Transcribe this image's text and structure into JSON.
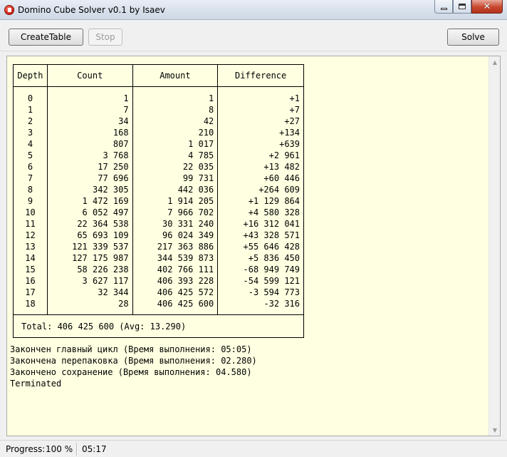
{
  "window": {
    "title": "Domino Cube Solver v0.1 by Isaev"
  },
  "toolbar": {
    "create_table": "CreateTable",
    "stop": "Stop",
    "solve": "Solve"
  },
  "table": {
    "headers": [
      "Depth",
      "Count",
      "Amount",
      "Difference"
    ],
    "rows": [
      [
        "0",
        "1",
        "1",
        "+1"
      ],
      [
        "1",
        "7",
        "8",
        "+7"
      ],
      [
        "2",
        "34",
        "42",
        "+27"
      ],
      [
        "3",
        "168",
        "210",
        "+134"
      ],
      [
        "4",
        "807",
        "1 017",
        "+639"
      ],
      [
        "5",
        "3 768",
        "4 785",
        "+2 961"
      ],
      [
        "6",
        "17 250",
        "22 035",
        "+13 482"
      ],
      [
        "7",
        "77 696",
        "99 731",
        "+60 446"
      ],
      [
        "8",
        "342 305",
        "442 036",
        "+264 609"
      ],
      [
        "9",
        "1 472 169",
        "1 914 205",
        "+1 129 864"
      ],
      [
        "10",
        "6 052 497",
        "7 966 702",
        "+4 580 328"
      ],
      [
        "11",
        "22 364 538",
        "30 331 240",
        "+16 312 041"
      ],
      [
        "12",
        "65 693 109",
        "96 024 349",
        "+43 328 571"
      ],
      [
        "13",
        "121 339 537",
        "217 363 886",
        "+55 646 428"
      ],
      [
        "14",
        "127 175 987",
        "344 539 873",
        "+5 836 450"
      ],
      [
        "15",
        "58 226 238",
        "402 766 111",
        "-68 949 749"
      ],
      [
        "16",
        "3 627 117",
        "406 393 228",
        "-54 599 121"
      ],
      [
        "17",
        "32 344",
        "406 425 572",
        "-3 594 773"
      ],
      [
        "18",
        "28",
        "406 425 600",
        "-32 316"
      ]
    ],
    "total": "Total: 406 425 600 (Avg: 13.290)"
  },
  "log": [
    "Закончен главный цикл (Время выполнения: 05:05)",
    "Закончена перепаковка (Время выполнения: 02.280)",
    "Закончено сохранение (Время выполнения: 04.580)",
    "Terminated"
  ],
  "status": {
    "progress_label": "Progress:",
    "progress_value": "100 %",
    "elapsed": "05:17"
  }
}
